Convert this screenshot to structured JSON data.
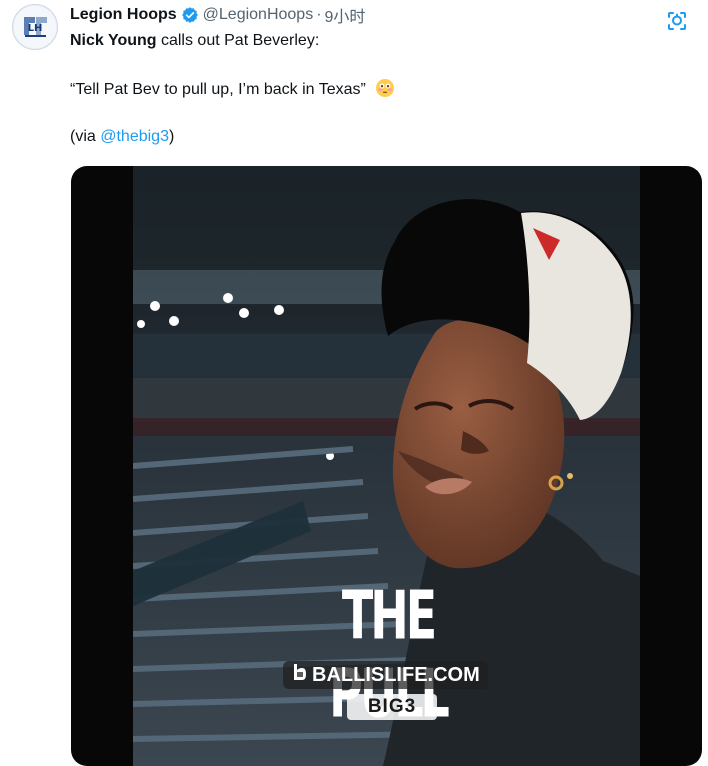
{
  "tweet": {
    "author_name": "Legion Hoops",
    "author_handle": "@LegionHoops",
    "separator": "·",
    "timestamp": "9小时",
    "line1_name": "Nick Young",
    "line1_rest": " calls out Pat Beverley:",
    "quote": "“Tell Pat Bev to pull up, I’m back in Texas”",
    "via_prefix": "(via ",
    "via_link": "@thebig3",
    "via_suffix": ")"
  },
  "media": {
    "overlay_title": "THE PULL",
    "overlay_site": "BALLISLIFE.COM",
    "overlay_logo": "BIG3"
  },
  "icons": {
    "avatar": "legion-hoops-logo",
    "verified": "verified-badge",
    "grok": "grok-icon",
    "emoji": "flushed-face-emoji"
  },
  "colors": {
    "link": "#1d9bf0",
    "verified": "#1d9bf0",
    "secondary_text": "#536471"
  }
}
